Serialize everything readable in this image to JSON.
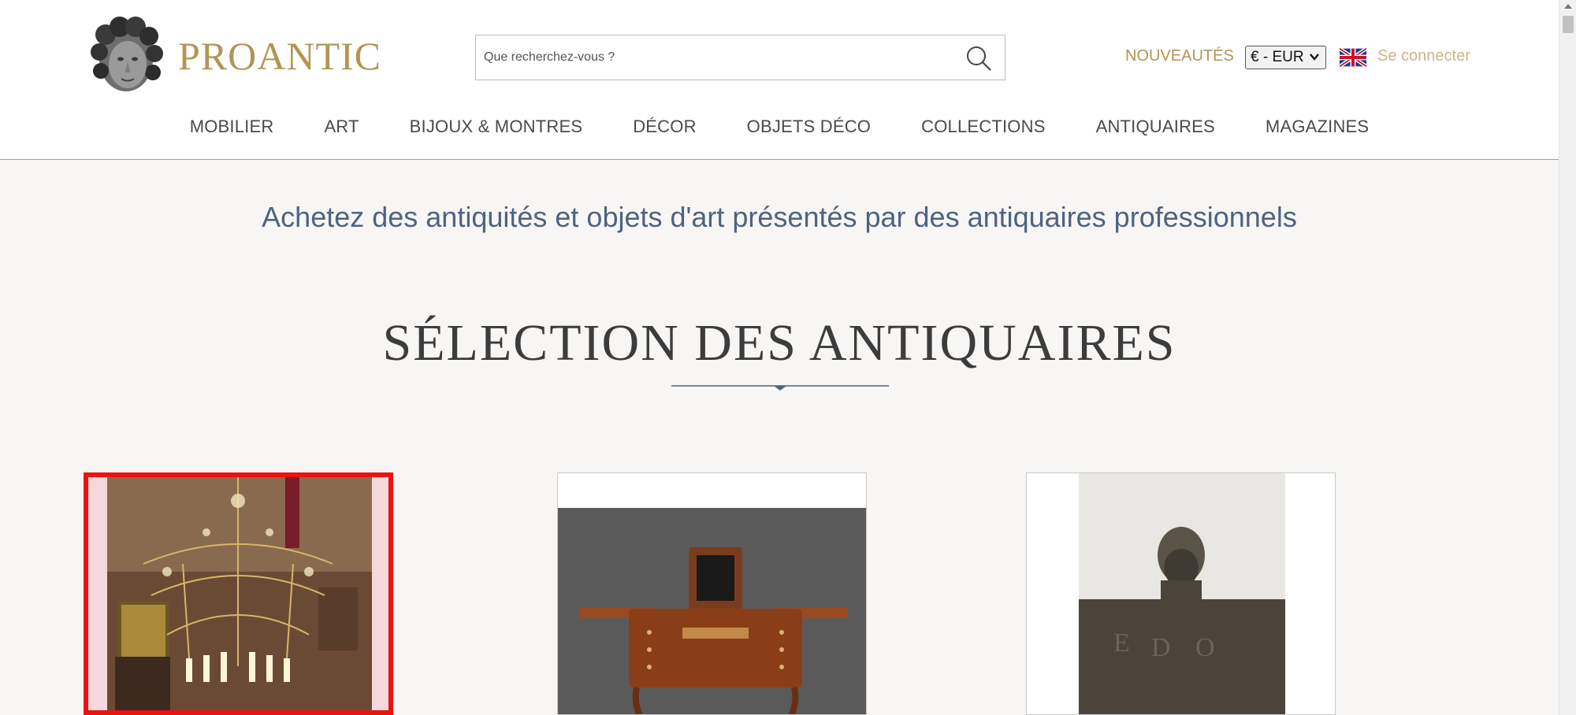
{
  "header": {
    "brand": "PROANTIC",
    "search": {
      "placeholder": "Que recherchez-vous ?",
      "value": ""
    },
    "new_link": "NOUVEAUTÉS",
    "currency": "€ - EUR",
    "language_flag": "uk-flag-icon",
    "login_link": "Se connecter",
    "colors": {
      "brand": "#b39453",
      "login": "#c9b48a"
    }
  },
  "nav": {
    "items": [
      {
        "label": "MOBILIER"
      },
      {
        "label": "ART"
      },
      {
        "label": "BIJOUX & MONTRES"
      },
      {
        "label": "DÉCOR"
      },
      {
        "label": "OBJETS DÉCO"
      },
      {
        "label": "COLLECTIONS"
      },
      {
        "label": "ANTIQUAIRES"
      },
      {
        "label": "MAGAZINES"
      }
    ]
  },
  "main": {
    "tagline": "Achetez des antiquités et objets d'art présentés par des antiquaires professionnels",
    "section_title": "SÉLECTION DES ANTIQUAIRES",
    "cards": [
      {
        "image": "chandelier-photo",
        "highlighted": true
      },
      {
        "image": "dressing-table-photo",
        "highlighted": false
      },
      {
        "image": "bronze-sculpture-photo",
        "highlighted": false
      }
    ],
    "colors": {
      "tagline": "#4d6380",
      "highlight_border": "#ee1111"
    }
  }
}
